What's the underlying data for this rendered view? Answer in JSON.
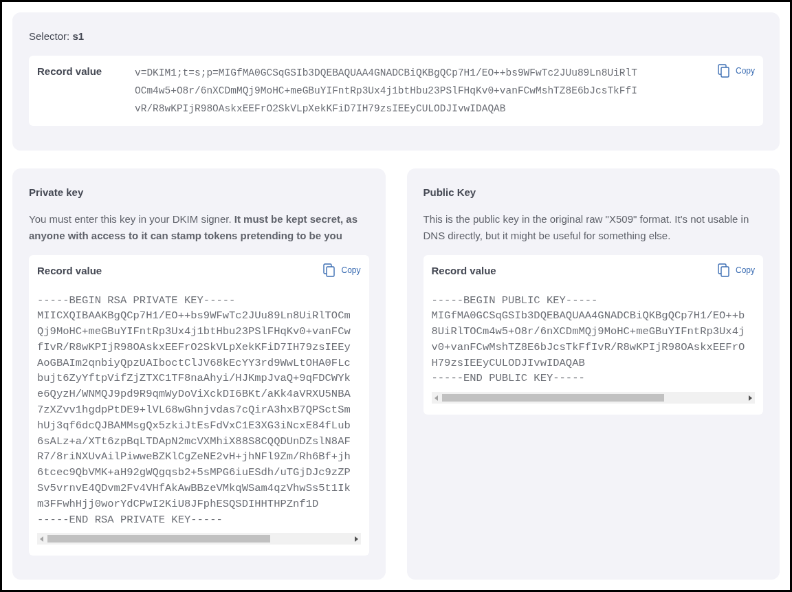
{
  "selector_card": {
    "selector": "Selector: **s1**",
    "record": {
      "label": "Record value",
      "copy": "Copy",
      "lines": [
        "v=DKIM1;t=s;p=MIGfMA0GCSqGSIb3DQEBAQUAA4GNADCBiQKBgQCp7H1/EO++bs9WFwTc2JUu89Ln8UiRlT",
        "OCm4w5+O8r/6nXCDmMQj9MoHC+meGBuYIFntRp3Ux4j1btHbu23PSlFHqKv0+vanFCwMshTZ8E6bJcsTkFfI",
        "vR/R8wKPIjR98OAskxEEFrO2SkVLpXekKFiD7IH79zsIEEyCULODJIvwIDAQAB"
      ]
    }
  },
  "key_cards": [
    {
      "title": "Private key",
      "description": "You must enter this key in your DKIM signer. **It must be kept secret, as anyone with access to it can stamp tokens pretending to be you**",
      "record": {
        "label": "Record value",
        "copy": "Copy",
        "lines": [
          "-----BEGIN RSA PRIVATE KEY-----",
          "MIICXQIBAAKBgQCp7H1/EO++bs9WFwTc2JUu89Ln8UiRlTOCm",
          "Qj9MoHC+meGBuYIFntRp3Ux4j1btHbu23PSlFHqKv0+vanFCw",
          "fIvR/R8wKPIjR98OAskxEEFrO2SkVLpXekKFiD7IH79zsIEEy",
          "AoGBAIm2qnbiyQpzUAIboctClJV68kEcYY3rd9WwLtOHA0FLc",
          "bujt6ZyYftpVifZjZTXC1TF8naAhyi/HJKmpJvaQ+9qFDCWYk",
          "e6QyzH/WNMQJ9pd9R9qmWyDoViXckDI6BKt/aKk4aVRXU5NBA",
          "7zXZvv1hgdpPtDE9+lVL68wGhnjvdas7cQirA3hxB7QPSctSm",
          "hUj3qf6dcQJBAMMsgQx5zkiJtEsFdVxC1E3XG3iNcxE84fLub",
          "6sALz+a/XTt6zpBqLTDApN2mcVXMhiX88S8CQQDUnDZslN8AF",
          "R7/8riNXUvAilPiwweBZKlCgZeNE2vH+jhNFl9Zm/Rh6Bf+jh",
          "6tcec9QbVMK+aH92gWQgqsb2+5sMPG6iuESdh/uTGjDJc9zZP",
          "Sv5vrnvE4QDvm2Fv4VHfAkAwBBzeVMkqWSam4qzVhwSs5t1Ik",
          "m3FFwhHjj0worYdCPwI2KiU8JFphESQSDIHHTHPZnf1D",
          "-----END RSA PRIVATE KEY-----"
        ]
      }
    },
    {
      "title": "Public Key",
      "description": "This is the public key in the original raw \"X509\" format. It's not usable in DNS directly, but it might be useful for something else.",
      "record": {
        "label": "Record value",
        "copy": "Copy",
        "lines": [
          "-----BEGIN PUBLIC KEY-----",
          "MIGfMA0GCSqGSIb3DQEBAQUAA4GNADCBiQKBgQCp7H1/EO++b",
          "8UiRlTOCm4w5+O8r/6nXCDmMQj9MoHC+meGBuYIFntRp3Ux4j",
          "v0+vanFCwMshTZ8E6bJcsTkFfIvR/R8wKPIjR98OAskxEEFrO",
          "H79zsIEEyCULODJIvwIDAQAB",
          "-----END PUBLIC KEY-----"
        ]
      }
    }
  ]
}
